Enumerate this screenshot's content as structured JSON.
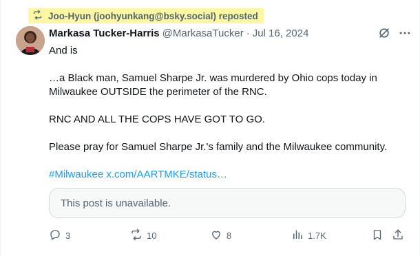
{
  "repost": {
    "label": "Joo-Hyun (joohyunkang@bsky.social) reposted",
    "icon": "repost-icon",
    "highlight_color": "#fbf7a3"
  },
  "post": {
    "author_name": "Markasa Tucker-Harris",
    "author_handle": "@MarkasaTucker",
    "separator": "·",
    "date": "Jul 16, 2024",
    "lines": [
      "And is",
      "…a Black man, Samuel Sharpe Jr. was murdered by Ohio cops today in",
      "Milwaukee OUTSIDE the perimeter of the RNC.",
      "RNC AND ALL THE COPS HAVE GOT TO GO.",
      "Please pray for Samuel Sharpe Jr.'s family and the Milwaukee community."
    ],
    "hashtag": "#Milwaukee",
    "link": "x.com/AARTMKE/status…",
    "quote_unavailable": "This post is unavailable."
  },
  "actions": {
    "replies": "3",
    "reposts": "10",
    "likes": "8",
    "views": "1.7K"
  },
  "colors": {
    "link": "#1d9bf0",
    "muted": "#536471",
    "text": "#0f1419"
  }
}
